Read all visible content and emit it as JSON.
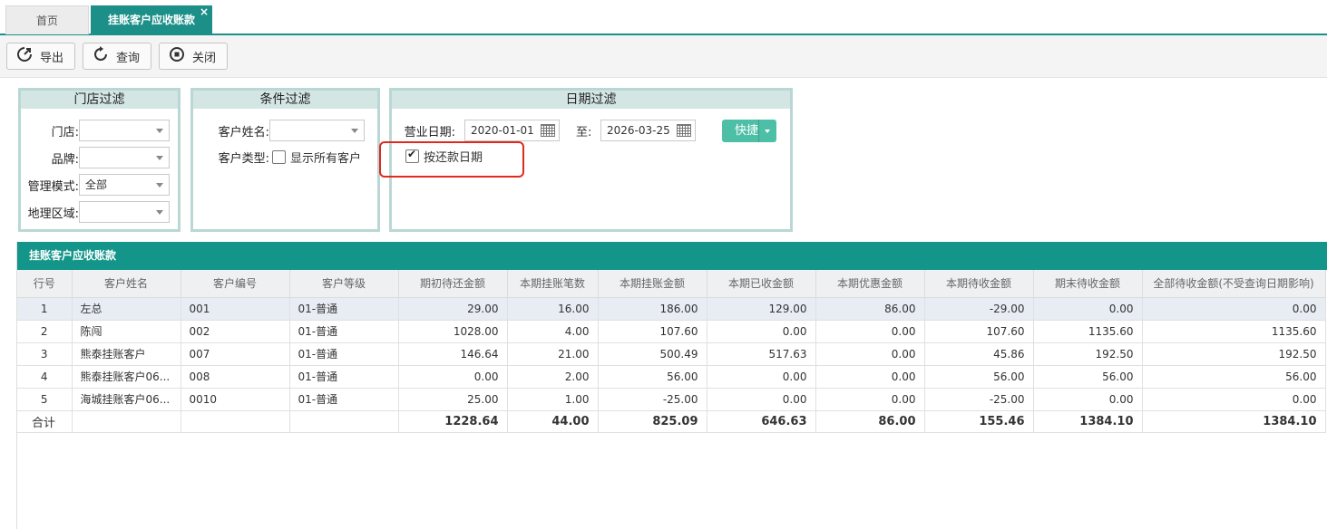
{
  "tabs": {
    "home": "首页",
    "active": "挂账客户应收账款",
    "close": "×"
  },
  "toolbar": {
    "export": "导出",
    "query": "查询",
    "close": "关闭"
  },
  "store_filter": {
    "title": "门店过滤",
    "store_label": "门店:",
    "store_value": "",
    "brand_label": "品牌:",
    "brand_value": "",
    "mode_label": "管理模式:",
    "mode_value": "全部",
    "region_label": "地理区域:",
    "region_value": ""
  },
  "cond_filter": {
    "title": "条件过滤",
    "name_label": "客户姓名:",
    "name_value": "",
    "type_label": "客户类型:",
    "show_all_label": "显示所有客户",
    "show_all_checked": false
  },
  "date_filter": {
    "title": "日期过滤",
    "biz_date_label": "营业日期:",
    "start_date": "2020-01-01",
    "to_label": "至:",
    "end_date": "2026-03-25",
    "quick_label": "快捷",
    "repay_label": "按还款日期",
    "repay_checked": true
  },
  "grid": {
    "title": "挂账客户应收账款",
    "columns": [
      "行号",
      "客户姓名",
      "客户编号",
      "客户等级",
      "期初待还金额",
      "本期挂账笔数",
      "本期挂账金额",
      "本期已收金额",
      "本期优惠金额",
      "本期待收金额",
      "期末待收金额",
      "全部待收金额(不受查询日期影响)"
    ],
    "rows": [
      [
        "1",
        "左总",
        "001",
        "01-普通",
        "29.00",
        "16.00",
        "186.00",
        "129.00",
        "86.00",
        "-29.00",
        "0.00",
        "0.00"
      ],
      [
        "2",
        "陈闯",
        "002",
        "01-普通",
        "1028.00",
        "4.00",
        "107.60",
        "0.00",
        "0.00",
        "107.60",
        "1135.60",
        "1135.60"
      ],
      [
        "3",
        "熊泰挂账客户",
        "007",
        "01-普通",
        "146.64",
        "21.00",
        "500.49",
        "517.63",
        "0.00",
        "45.86",
        "192.50",
        "192.50"
      ],
      [
        "4",
        "熊泰挂账客户06...",
        "008",
        "01-普通",
        "0.00",
        "2.00",
        "56.00",
        "0.00",
        "0.00",
        "56.00",
        "56.00",
        "56.00"
      ],
      [
        "5",
        "海城挂账客户06...",
        "0010",
        "01-普通",
        "25.00",
        "1.00",
        "-25.00",
        "0.00",
        "0.00",
        "-25.00",
        "0.00",
        "0.00"
      ]
    ],
    "total": [
      "合计",
      "",
      "",
      "",
      "1228.64",
      "44.00",
      "825.09",
      "646.63",
      "86.00",
      "155.46",
      "1384.10",
      "1384.10"
    ]
  }
}
